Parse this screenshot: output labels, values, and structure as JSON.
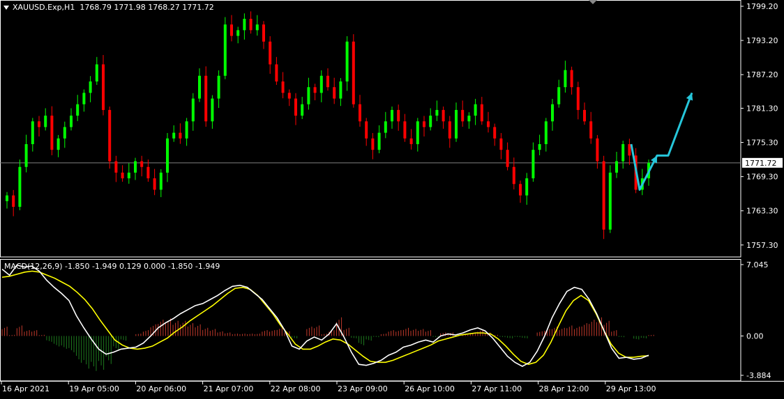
{
  "header": {
    "symbol": "XAUUSD.Exp,H1",
    "ohlc": "1768.79 1771.98 1768.27 1771.72"
  },
  "macd_header": {
    "label": "MACD(12,26,9) -1.850 -1.949 0.129 0.000 -1.850 -1.949"
  },
  "colors": {
    "background": "#000000",
    "bull": "#00ff00",
    "bear": "#ff0000",
    "macd_line": "#ffffff",
    "signal_line": "#ffff00",
    "arrow": "#26c6da",
    "grid": "#ffffff",
    "price_line": "#808080"
  },
  "icons": {
    "menu_triangle": "triangle-down-icon"
  },
  "chart_data": [
    {
      "type": "candlestick",
      "price_axis_ticks": [
        "1799.20",
        "1793.20",
        "1787.20",
        "1781.30",
        "1775.30",
        "1769.30",
        "1763.30",
        "1757.30"
      ],
      "current_price": "1771.72",
      "ylim": [
        1755.2,
        1800.3
      ],
      "x_tick_labels": [
        "16 Apr 2021",
        "19 Apr 05:00",
        "20 Apr 06:00",
        "21 Apr 07:00",
        "22 Apr 08:00",
        "23 Apr 09:00",
        "26 Apr 10:00",
        "27 Apr 11:00",
        "28 Apr 12:00",
        "29 Apr 13:00"
      ],
      "closes": [
        1766,
        1764,
        1771,
        1775,
        1779,
        1778,
        1780,
        1774,
        1776,
        1778,
        1780,
        1782,
        1784,
        1786,
        1789,
        1781,
        1772,
        1770,
        1769,
        1770,
        1772,
        1771,
        1769,
        1767,
        1770,
        1776,
        1777,
        1776,
        1779,
        1783,
        1787,
        1779,
        1783,
        1787,
        1796,
        1794,
        1795,
        1797,
        1795,
        1796,
        1793,
        1789,
        1786,
        1784,
        1783,
        1780,
        1782,
        1785,
        1784,
        1787,
        1785,
        1783,
        1786,
        1793,
        1782,
        1779,
        1776,
        1774,
        1777,
        1779,
        1781,
        1779,
        1776,
        1775,
        1779,
        1778,
        1780,
        1781,
        1779,
        1776,
        1781,
        1779,
        1780,
        1782,
        1779,
        1778,
        1776,
        1774,
        1771,
        1768,
        1766,
        1769,
        1774,
        1775,
        1779,
        1782,
        1785,
        1788,
        1785,
        1781,
        1779,
        1776,
        1772,
        1760,
        1770,
        1772,
        1775,
        1773,
        1767,
        1769,
        1771.7
      ],
      "projection_arrow_path": [
        [
          1767,
          1758
        ],
        [
          1778,
          1773
        ],
        [
          1773,
          1779
        ],
        [
          1782,
          1784
        ]
      ]
    },
    {
      "type": "line",
      "name": "MACD(12,26,9)",
      "axis_ticks": [
        "7.045",
        "0.00",
        "-3.884"
      ],
      "ylim": [
        -3.884,
        7.045
      ],
      "macd_values": [
        6.6,
        6.0,
        7.0,
        6.8,
        6.9,
        6.4,
        5.5,
        4.8,
        4.2,
        3.5,
        2.0,
        0.8,
        -0.3,
        -1.3,
        -1.8,
        -1.6,
        -1.3,
        -1.2,
        -1.1,
        -0.7,
        0.0,
        0.8,
        1.3,
        1.7,
        2.2,
        2.6,
        3.0,
        3.2,
        3.6,
        4.0,
        4.5,
        4.9,
        5.0,
        4.8,
        4.2,
        3.6,
        2.7,
        1.8,
        0.6,
        -1.0,
        -1.3,
        -0.5,
        -0.1,
        -0.4,
        0.2,
        1.2,
        -0.1,
        -1.6,
        -2.8,
        -2.9,
        -2.7,
        -2.4,
        -1.9,
        -1.6,
        -1.1,
        -0.9,
        -0.6,
        -0.4,
        -0.6,
        0.0,
        0.2,
        0.1,
        0.3,
        0.6,
        0.8,
        0.5,
        -0.2,
        -1.1,
        -2.0,
        -2.6,
        -3.0,
        -2.6,
        -1.5,
        0.0,
        1.8,
        3.2,
        4.4,
        4.8,
        4.6,
        3.6,
        2.2,
        0.5,
        -1.2,
        -2.2,
        -2.1,
        -2.3,
        -2.2,
        -1.9
      ],
      "signal_values": [
        5.8,
        5.9,
        6.1,
        6.3,
        6.4,
        6.3,
        6.0,
        5.7,
        5.3,
        4.9,
        4.3,
        3.6,
        2.7,
        1.6,
        0.6,
        -0.4,
        -0.9,
        -1.2,
        -1.3,
        -1.2,
        -1.0,
        -0.6,
        -0.2,
        0.4,
        0.9,
        1.5,
        2.0,
        2.5,
        3.0,
        3.6,
        4.2,
        4.7,
        4.8,
        4.6,
        4.0,
        3.1,
        2.2,
        1.1,
        0.2,
        -0.8,
        -1.3,
        -1.3,
        -1.0,
        -0.6,
        -0.3,
        -0.4,
        -0.8,
        -1.4,
        -2.0,
        -2.5,
        -2.6,
        -2.6,
        -2.4,
        -2.1,
        -1.8,
        -1.5,
        -1.2,
        -0.9,
        -0.5,
        -0.3,
        -0.1,
        0.1,
        0.2,
        0.3,
        0.3,
        0.2,
        -0.3,
        -1.0,
        -1.8,
        -2.5,
        -2.8,
        -2.6,
        -1.9,
        -0.6,
        1.0,
        2.5,
        3.5,
        4.0,
        3.5,
        2.2,
        0.6,
        -0.8,
        -1.7,
        -2.1,
        -2.1,
        -2.0,
        -1.949
      ],
      "histogram_values": [
        0.8,
        0.1,
        0.9,
        0.5,
        0.5,
        0.1,
        -0.5,
        -0.9,
        -1.1,
        -1.4,
        -2.3,
        -2.8,
        -3.0,
        -2.9,
        -2.4,
        -1.2,
        -0.4,
        0.0,
        0.2,
        0.5,
        1.0,
        1.4,
        1.5,
        1.3,
        1.3,
        1.1,
        1.0,
        0.7,
        0.6,
        0.4,
        0.3,
        0.2,
        0.2,
        0.2,
        0.2,
        0.5,
        0.5,
        0.7,
        0.4,
        -0.2,
        0.0,
        0.8,
        0.9,
        0.2,
        0.5,
        1.6,
        0.7,
        -0.2,
        -0.8,
        -0.4,
        -0.1,
        0.2,
        0.5,
        0.5,
        0.7,
        0.6,
        0.6,
        0.5,
        -0.1,
        0.3,
        0.3,
        0.0,
        0.1,
        0.3,
        0.5,
        0.3,
        0.1,
        -0.1,
        -0.2,
        -0.1,
        -0.2,
        0.0,
        0.4,
        0.6,
        0.8,
        0.7,
        0.9,
        0.8,
        1.1,
        1.4,
        1.6,
        1.3,
        0.5,
        -0.1,
        0.0,
        -0.3,
        -0.2,
        0.1
      ]
    }
  ]
}
